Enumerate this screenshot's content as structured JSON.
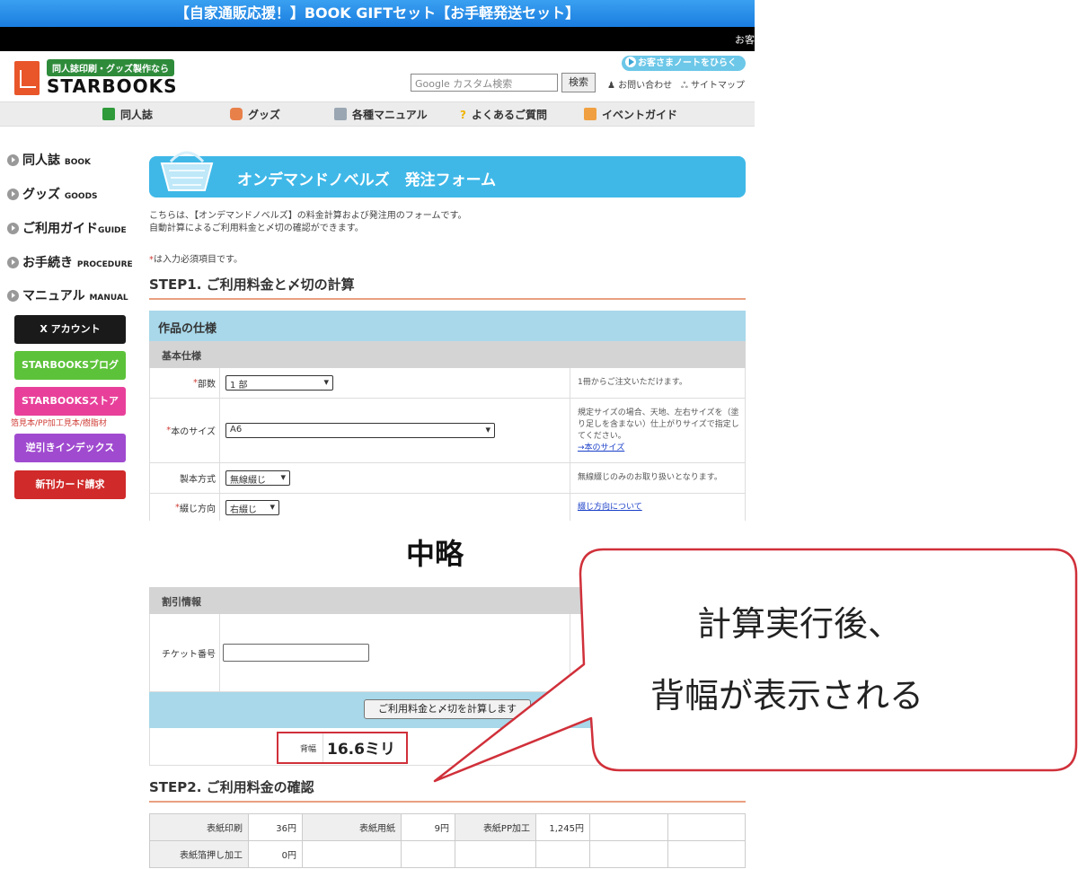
{
  "banner": {
    "text": "【自家通販応援！】BOOK GIFTセット【お手軽発送セット】",
    "corner_text": "お客"
  },
  "header": {
    "logo_tag": "同人誌印刷・グッズ製作なら",
    "logo_name": "STARBOOKS",
    "search_placeholder": "Google カスタム検索",
    "search_button": "検索",
    "customer_note": "お客さまノートをひらく",
    "contact": "お問い合わせ",
    "sitemap": "サイトマップ"
  },
  "nav": [
    {
      "label": "同人誌",
      "icon": "book-icon",
      "color": "#2e9a3a"
    },
    {
      "label": "グッズ",
      "icon": "goods-icon",
      "color": "#e8804a"
    },
    {
      "label": "各種マニュアル",
      "icon": "manual-icon",
      "color": "#9aa6b2"
    },
    {
      "label": "よくあるご質問",
      "icon": "question-icon",
      "color": "#f0b400"
    },
    {
      "label": "イベントガイド",
      "icon": "event-icon",
      "color": "#f0a040"
    }
  ],
  "sidebar": {
    "items": [
      {
        "label": "同人誌",
        "sub": "BOOK"
      },
      {
        "label": "グッズ",
        "sub": "GOODS"
      },
      {
        "label": "ご利用ガイド",
        "sub": "GUIDE"
      },
      {
        "label": "お手続き",
        "sub": "PROCEDURE"
      },
      {
        "label": "マニュアル",
        "sub": "MANUAL"
      }
    ],
    "banners": [
      {
        "label": "X アカウント",
        "color": "#1a1a1a"
      },
      {
        "label": "STARBOOKSブログ",
        "color": "#5cc23a"
      },
      {
        "label": "STARBOOKSストア",
        "color": "#e8409a"
      },
      {
        "label": "逆引きインデックス",
        "color": "#a04ad0"
      },
      {
        "label": "新刊カード請求",
        "color": "#d02a2a"
      }
    ],
    "store_note": "箔見本/PP加工見本/樹脂材"
  },
  "main": {
    "title": "オンデマンドノベルズ　発注フォーム",
    "intro_1": "こちらは、【オンデマンドノベルズ】の料金計算および発注用のフォームです。",
    "intro_2": "自動計算によるご利用料金と〆切の確認ができます。",
    "required_note": "は入力必須項目です。",
    "step1": "STEP1. ご利用料金と〆切の計算",
    "spec_head": "作品の仕様",
    "basic_head": "基本仕様",
    "rows": [
      {
        "label": "部数",
        "value": "1 部",
        "note": "1冊からご注文いただけます。"
      },
      {
        "label": "本のサイズ",
        "value": "A6",
        "note": "規定サイズの場合、天地、左右サイズを（塗り足しを含まない）仕上がりサイズで指定してください。",
        "link": "→本のサイズ"
      },
      {
        "label": "製本方式",
        "value": "無線綴じ",
        "note": "無線綴じのみのお取り扱いとなります。"
      },
      {
        "label": "綴じ方向",
        "value": "右綴じ",
        "link": "綴じ方向について"
      }
    ],
    "omitted": "中略",
    "discount_head": "割引情報",
    "ticket_label": "チケット番号",
    "calc_button": "ご利用料金と〆切を計算します",
    "spine_label": "背幅",
    "spine_value": "16.6ミリ",
    "step2": "STEP2. ご利用料金の確認",
    "fees": [
      [
        {
          "label": "表紙印刷",
          "value": "36円"
        },
        {
          "label": "表紙用紙",
          "value": "9円"
        },
        {
          "label": "表紙PP加工",
          "value": "1,245円"
        }
      ],
      [
        {
          "label": "表紙箔押し加工",
          "value": "0円"
        }
      ]
    ]
  },
  "callout": {
    "line1": "計算実行後、",
    "line2": "背幅が表示される",
    "border_color": "#d0303a"
  }
}
